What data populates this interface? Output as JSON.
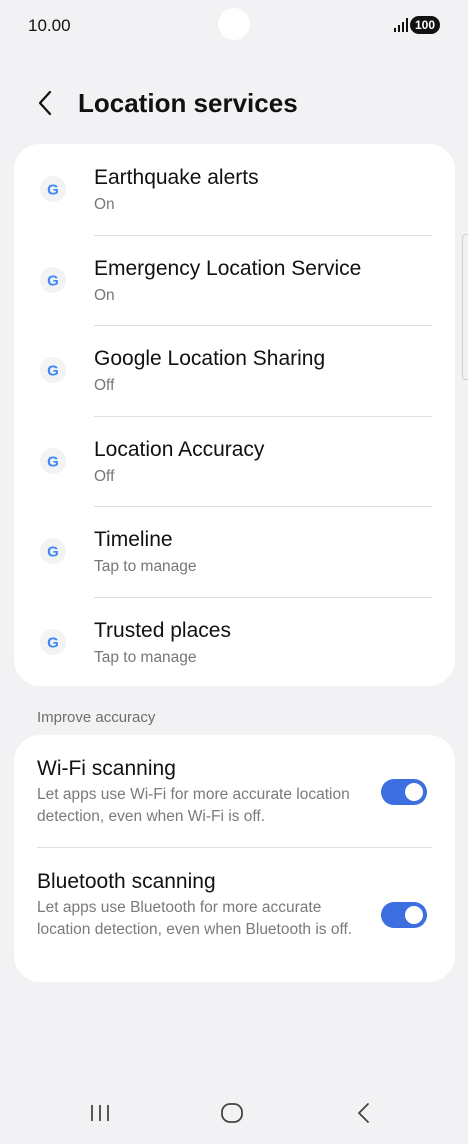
{
  "status_bar": {
    "time": "10.00",
    "battery": "100"
  },
  "header": {
    "title": "Location services"
  },
  "services": {
    "items": [
      {
        "title": "Earthquake alerts",
        "subtitle": "On",
        "icon": "google-icon"
      },
      {
        "title": "Emergency Location Service",
        "subtitle": "On",
        "icon": "google-icon"
      },
      {
        "title": "Google Location Sharing",
        "subtitle": "Off",
        "icon": "google-icon"
      },
      {
        "title": "Location Accuracy",
        "subtitle": "Off",
        "icon": "google-icon"
      },
      {
        "title": "Timeline",
        "subtitle": "Tap to manage",
        "icon": "google-icon"
      },
      {
        "title": "Trusted places",
        "subtitle": "Tap to manage",
        "icon": "google-icon"
      }
    ]
  },
  "accuracy": {
    "section_label": "Improve accuracy",
    "items": [
      {
        "title": "Wi-Fi scanning",
        "description": "Let apps use Wi-Fi for more accurate location detection, even when Wi-Fi is off.",
        "enabled": true
      },
      {
        "title": "Bluetooth scanning",
        "description": "Let apps use Bluetooth for more accurate location detection, even when Bluetooth is off.",
        "enabled": true
      }
    ]
  },
  "colors": {
    "background": "#f2f2f5",
    "card": "#ffffff",
    "accent": "#3d6fe0",
    "secondary_text": "#777777"
  },
  "nav": {
    "icons": [
      "recent-apps-icon",
      "home-icon",
      "back-icon"
    ]
  }
}
